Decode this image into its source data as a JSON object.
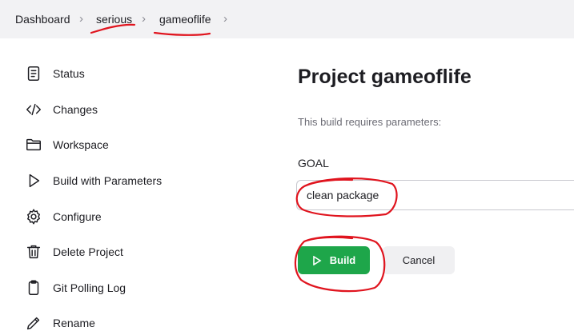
{
  "breadcrumb": {
    "items": [
      "Dashboard",
      "serious",
      "gameoflife"
    ],
    "separator": "›"
  },
  "sidebar": {
    "items": [
      {
        "label": "Status",
        "icon": "status-icon"
      },
      {
        "label": "Changes",
        "icon": "code-icon"
      },
      {
        "label": "Workspace",
        "icon": "folder-icon"
      },
      {
        "label": "Build with Parameters",
        "icon": "play-icon"
      },
      {
        "label": "Configure",
        "icon": "gear-icon"
      },
      {
        "label": "Delete Project",
        "icon": "trash-icon"
      },
      {
        "label": "Git Polling Log",
        "icon": "clipboard-icon"
      },
      {
        "label": "Rename",
        "icon": "pencil-icon"
      }
    ]
  },
  "main": {
    "title": "Project gameoflife",
    "subtitle": "This build requires parameters:",
    "parameter": {
      "name": "GOAL",
      "value": "clean package"
    },
    "build_label": "Build",
    "cancel_label": "Cancel"
  },
  "colors": {
    "build_button": "#1ea64a",
    "annotation": "#e0141e",
    "topbar": "#f2f2f4"
  }
}
